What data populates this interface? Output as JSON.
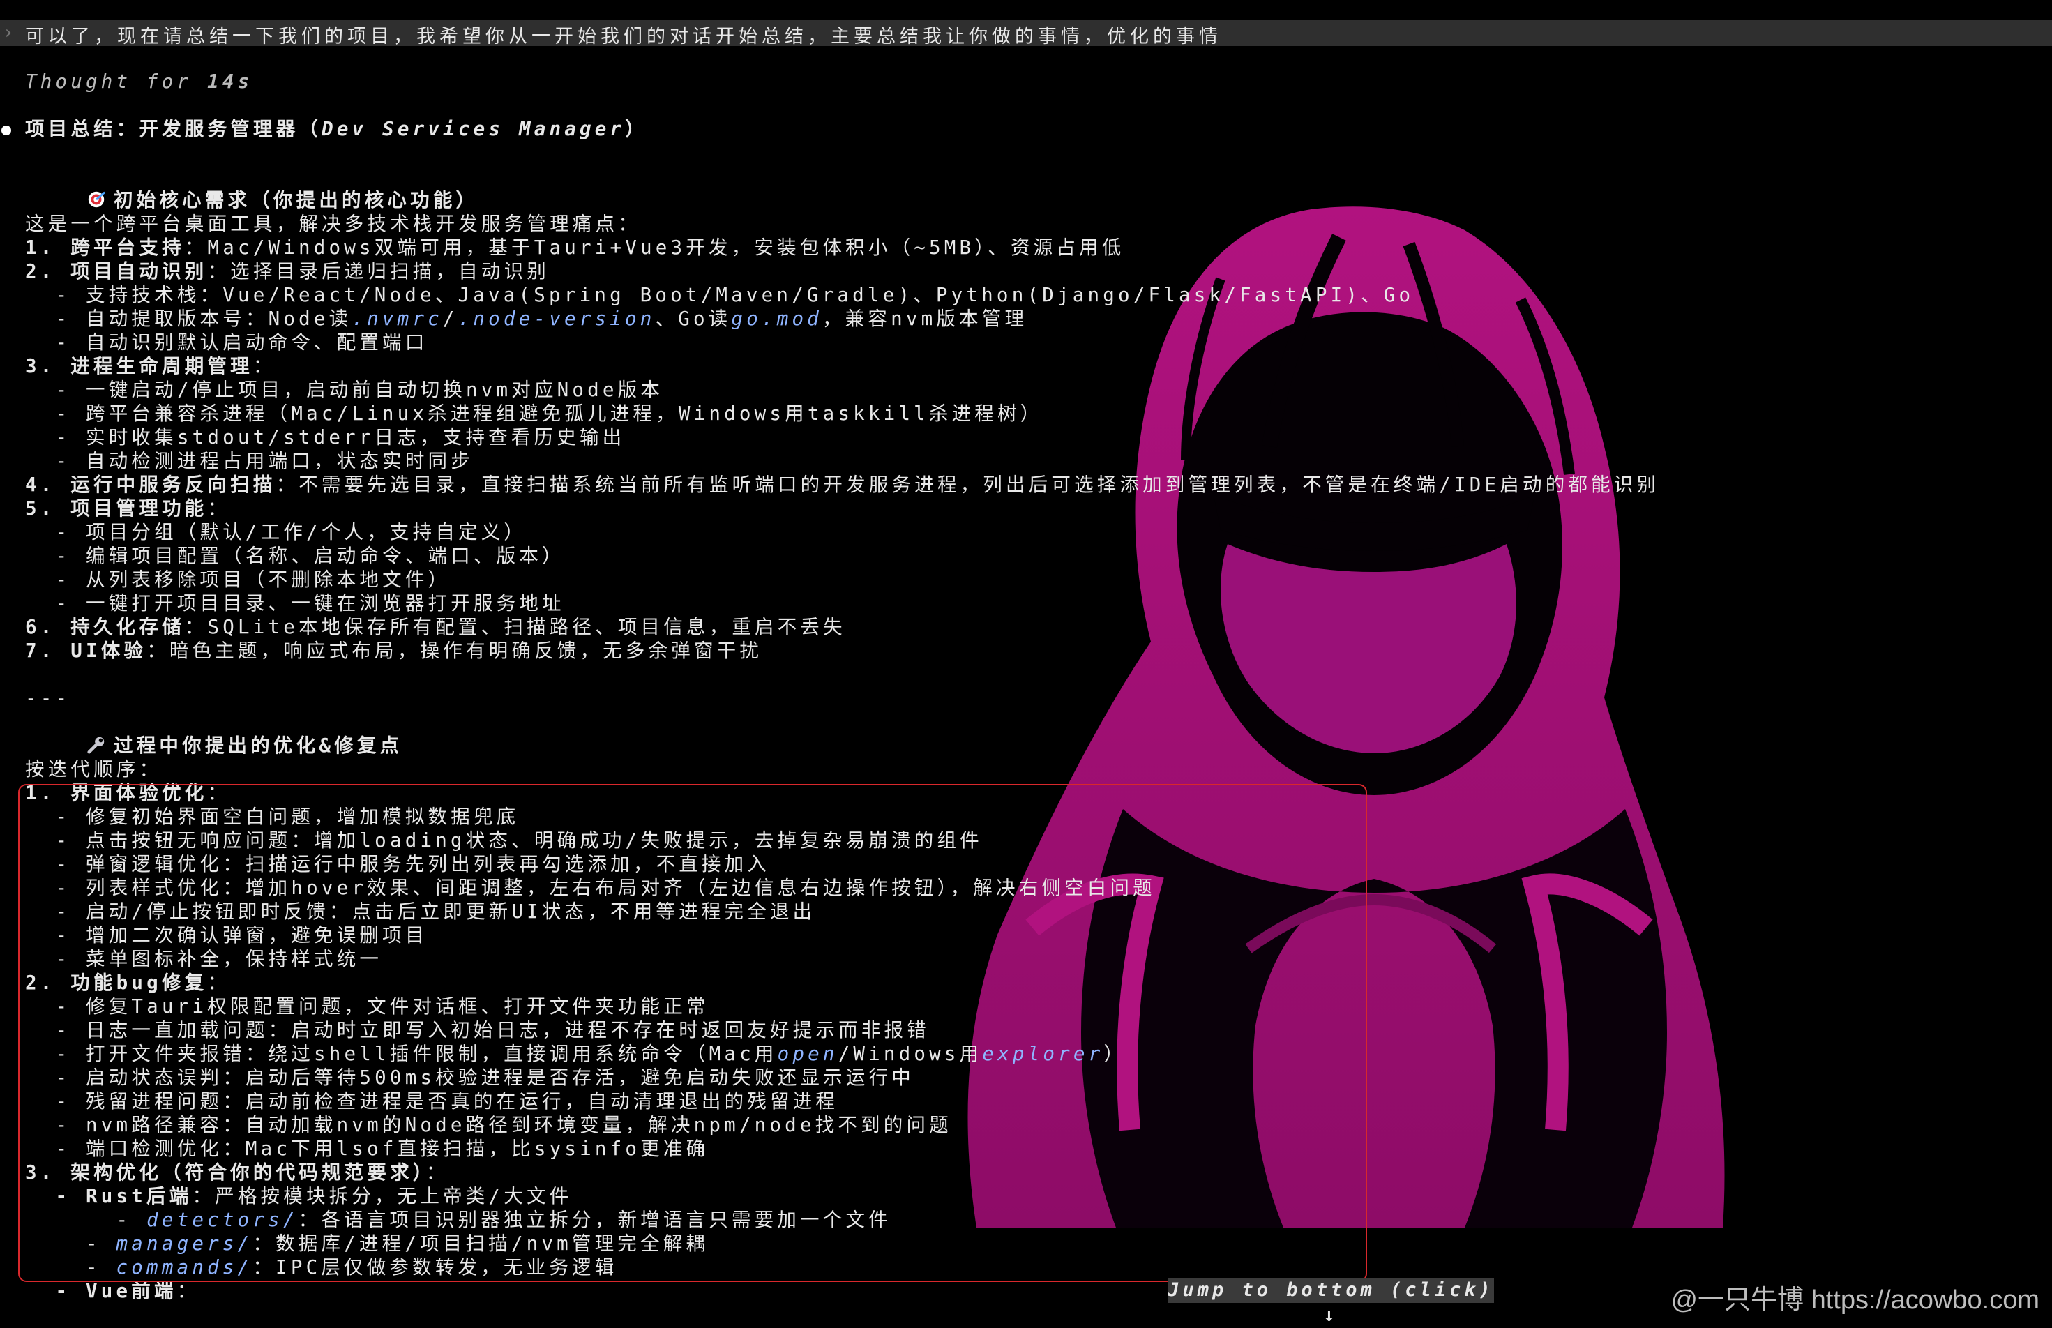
{
  "prompt": "可以了，现在请总结一下我们的项目，我希望你从一开始我们的对话开始总结，主要总结我让你做的事情，优化的事情",
  "thought": {
    "label": "Thought for ",
    "time": "14s"
  },
  "summary": {
    "title": "项目总结：开发服务管理器（",
    "title_en": "Dev Services Manager",
    "title_end": "）"
  },
  "section1": {
    "heading": "初始核心需求（你提出的核心功能）",
    "intro": "这是一个跨平台桌面工具，解决多技术栈开发服务管理痛点：",
    "items": {
      "i1_label": "1. 跨平台支持",
      "i1_text": "：Mac/Windows双端可用，基于Tauri+Vue3开发，安装包体积小（~5MB）、资源占用低",
      "i2_label": "2. 项目自动识别",
      "i2_text": "：选择目录后递归扫描，自动识别",
      "i2_a": "  - 支持技术栈：Vue/React/Node、Java(Spring Boot/Maven/Gradle)、Python(Django/Flask/FastAPI)、Go",
      "i2_b1": "  - 自动提取版本号：Node读",
      "i2_b_code1": ".nvmrc",
      "i2_b_slash": "/",
      "i2_b_code2": ".node-version",
      "i2_b2": "、Go读",
      "i2_b_code3": "go.mod",
      "i2_b3": "，兼容nvm版本管理",
      "i2_c": "  - 自动识别默认启动命令、配置端口",
      "i3_label": "3. 进程生命周期管理",
      "i3_text": "：",
      "i3_a": "  - 一键启动/停止项目，启动前自动切换nvm对应Node版本",
      "i3_b": "  - 跨平台兼容杀进程（Mac/Linux杀进程组避免孤儿进程，Windows用taskkill杀进程树）",
      "i3_c": "  - 实时收集stdout/stderr日志，支持查看历史输出",
      "i3_d": "  - 自动检测进程占用端口，状态实时同步",
      "i4_label": "4. 运行中服务反向扫描",
      "i4_text": "：不需要先选目录，直接扫描系统当前所有监听端口的开发服务进程，列出后可选择添加到管理列表，不管是在终端/IDE启动的都能识别",
      "i5_label": "5. 项目管理功能",
      "i5_text": "：",
      "i5_a": "  - 项目分组（默认/工作/个人，支持自定义）",
      "i5_b": "  - 编辑项目配置（名称、启动命令、端口、版本）",
      "i5_c": "  - 从列表移除项目（不删除本地文件）",
      "i5_d": "  - 一键打开项目目录、一键在浏览器打开服务地址",
      "i6_label": "6. 持久化存储",
      "i6_text": "：SQLite本地保存所有配置、扫描路径、项目信息，重启不丢失",
      "i7_label": "7. UI体验",
      "i7_text": "：暗色主题，响应式布局，操作有明确反馈，无多余弹窗干扰"
    }
  },
  "divider": "---",
  "section2": {
    "heading": "过程中你提出的优化&修复点",
    "intro": "按迭代顺序：",
    "g1_label": "1. 界面体验优化",
    "g1_text": "：",
    "g1_a": "  - 修复初始界面空白问题，增加模拟数据兜底",
    "g1_b": "  - 点击按钮无响应问题：增加loading状态、明确成功/失败提示，去掉复杂易崩溃的组件",
    "g1_c": "  - 弹窗逻辑优化：扫描运行中服务先列出列表再勾选添加，不直接加入",
    "g1_d": "  - 列表样式优化：增加hover效果、间距调整，左右布局对齐（左边信息右边操作按钮），解决右侧空白问题",
    "g1_e": "  - 启动/停止按钮即时反馈：点击后立即更新UI状态，不用等进程完全退出",
    "g1_f": "  - 增加二次确认弹窗，避免误删项目",
    "g1_g": "  - 菜单图标补全，保持样式统一",
    "g2_label": "2. 功能bug修复",
    "g2_text": "：",
    "g2_a": "  - 修复Tauri权限配置问题，文件对话框、打开文件夹功能正常",
    "g2_b": "  - 日志一直加载问题：启动时立即写入初始日志，进程不存在时返回友好提示而非报错",
    "g2_c1": "  - 打开文件夹报错：绕过shell插件限制，直接调用系统命令（Mac用",
    "g2_c_code1": "open",
    "g2_c2": "/Windows用",
    "g2_c_code2": "explorer",
    "g2_c3": "）",
    "g2_d": "  - 启动状态误判：启动后等待500ms校验进程是否存活，避免启动失败还显示运行中",
    "g2_e": "  - 残留进程问题：启动前检查进程是否真的在运行，自动清理退出的残留进程",
    "g2_f": "  - nvm路径兼容：自动加载nvm的Node路径到环境变量，解决npm/node找不到的问题",
    "g2_g": "  - 端口检测优化：Mac下用lsof直接扫描，比sysinfo更准确",
    "g3_label": "3. 架构优化（符合你的代码规范要求）",
    "g3_text": "：",
    "g3_a_label": "  - Rust后端",
    "g3_a_text": "：严格按模块拆分，无上帝类/大文件",
    "g3_a1_code": "detectors/",
    "g3_a1_text": "：各语言项目识别器独立拆分，新增语言只需要加一个文件",
    "g3_a2_code": "managers/",
    "g3_a2_text": "：数据库/进程/项目扫描/nvm管理完全解耦",
    "g3_a3_code": "commands/",
    "g3_a3_text": "：IPC层仅做参数转发，无业务逻辑",
    "g3_b_label": "  - Vue前端",
    "g3_b_text": "："
  },
  "jump_button": "Jump to bottom (click) ↓",
  "watermark": "@一只牛博 https://acowbo.com",
  "colors": {
    "accent": "#c0168f",
    "code": "#8fb4ff",
    "box": "#d8282c"
  }
}
